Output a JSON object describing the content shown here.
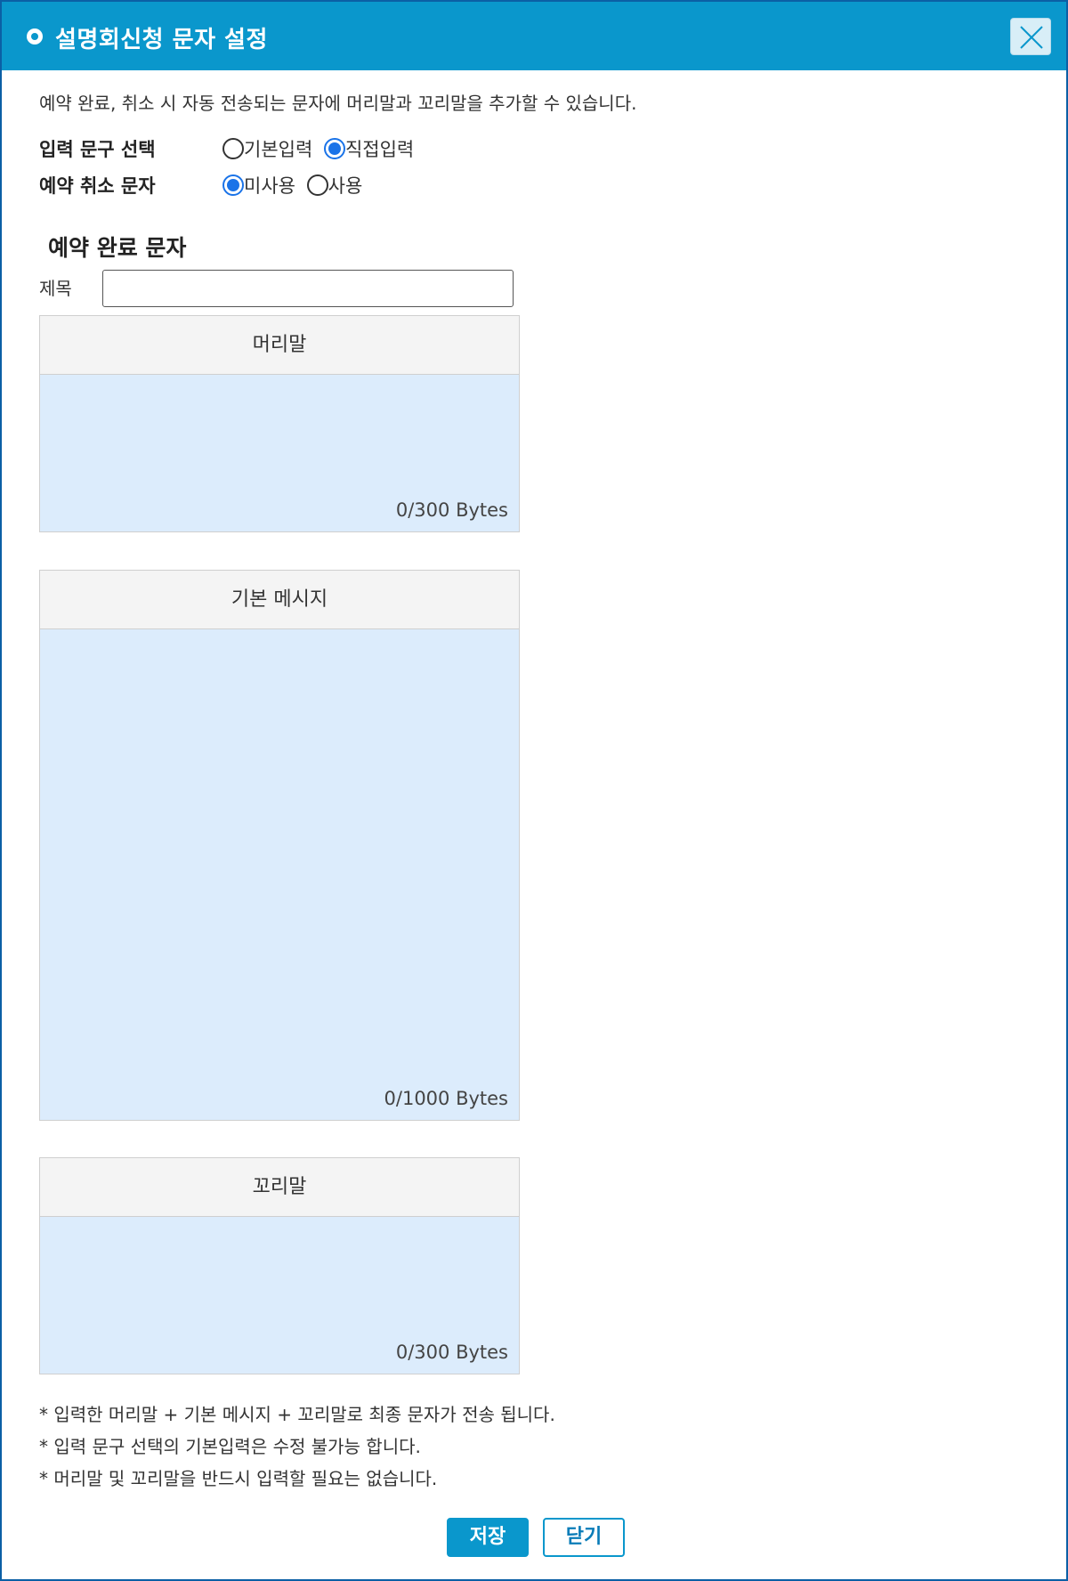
{
  "dialog": {
    "title": "설명회신청 문자 설정",
    "close_icon": "close-icon"
  },
  "intro": "예약 완료, 취소 시 자동 전송되는 문자에 머리말과 꼬리말을 추가할 수 있습니다.",
  "options": {
    "input_phrase": {
      "label": "입력 문구 선택",
      "choices": [
        "기본입력",
        "직접입력"
      ],
      "selected": "직접입력"
    },
    "cancel_message": {
      "label": "예약 취소 문자",
      "choices": [
        "미사용",
        "사용"
      ],
      "selected": "미사용"
    }
  },
  "section": {
    "title": "예약 완료 문자",
    "subject_label": "제목",
    "subject_value": ""
  },
  "boxes": {
    "header": {
      "title": "머리말",
      "bytes": "0/300 Bytes",
      "value": ""
    },
    "body": {
      "title": "기본 메시지",
      "bytes": "0/1000 Bytes",
      "value": ""
    },
    "footer": {
      "title": "꼬리말",
      "bytes": "0/300 Bytes",
      "value": ""
    }
  },
  "notes": [
    "* 입력한 머리말 + 기본 메시지 + 꼬리말로 최종 문자가 전송 됩니다.",
    "* 입력 문구 선택의 기본입력은 수정 불가능 합니다.",
    "* 머리말 및 꼬리말을 반드시 입력할 필요는 없습니다."
  ],
  "buttons": {
    "save": "저장",
    "close": "닫기"
  },
  "colors": {
    "title_bar": "#0a97cc",
    "radio_checked": "#1a73e8",
    "textarea_bg": "#dcecfc"
  }
}
